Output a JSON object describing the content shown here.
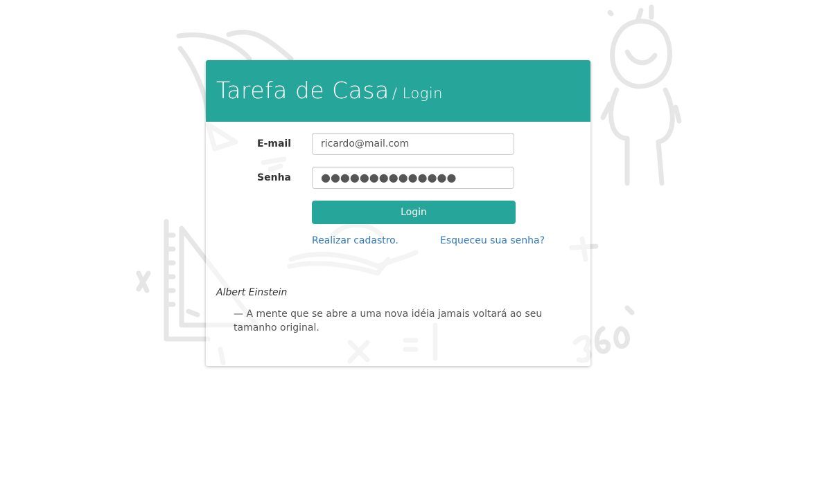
{
  "app": {
    "title": "Tarefa de Casa",
    "page": "/ Login",
    "brand_color": "#26a69a",
    "link_color": "#337ab7"
  },
  "form": {
    "email_label": "E-mail",
    "email_value": "ricardo@mail.com",
    "password_label": "Senha",
    "password_value": "●●●●●●●●●●●●●●",
    "submit_label": "Login"
  },
  "links": {
    "register": "Realizar cadastro.",
    "forgot_password": "Esqueceu sua senha?"
  },
  "quote": {
    "author": "Albert Einstein",
    "text": "— A mente que se abre a uma nova idéia jamais voltará ao seu tamanho original."
  },
  "background": {
    "doodle_icons": [
      "book-doodle",
      "stick-figure-doodle",
      "triangle-ruler-doodle",
      "open-book-doodle",
      "math-symbols-doodle"
    ]
  }
}
